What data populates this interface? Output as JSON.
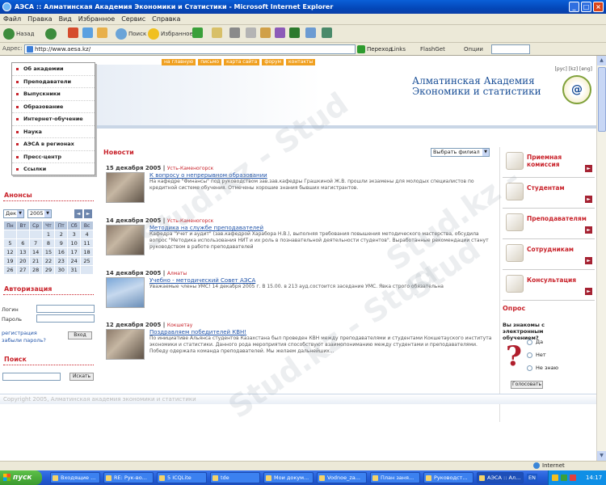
{
  "window": {
    "title": "АЭСА :: Алматинская Академия Экономики и Статистики - Microsoft Internet Explorer",
    "min": "_",
    "max": "□",
    "close": "×"
  },
  "menu": [
    "Файл",
    "Правка",
    "Вид",
    "Избранное",
    "Сервис",
    "Справка"
  ],
  "toolbar": {
    "back": "Назад",
    "search": "Поиск",
    "favorites": "Избранное"
  },
  "address": {
    "label": "Адрес:",
    "url": "http://www.aesa.kz/",
    "go": "Переход",
    "links": "Links",
    "flashget": "FlashGet",
    "options": "Опции"
  },
  "site": {
    "topnav": [
      "на главную",
      "письмо",
      "карта сайта",
      "форум",
      "контакты"
    ],
    "langs": "[рус] [kz] [eng]",
    "academy_line1": "Алматинская Академия",
    "academy_line2": "Экономики и статистики",
    "logo_char": "@",
    "leftnav": [
      "Об академии",
      "Преподаватели",
      "Выпускники",
      "Образование",
      "Интернет-обучение",
      "Наука",
      "АЭСА в регионах",
      "Пресс-центр",
      "Ссылки"
    ],
    "announcements": {
      "title": "Анонсы",
      "month": "Дек",
      "year": "2005",
      "prev": "◄",
      "next": "►",
      "days": [
        "Пн",
        "Вт",
        "Ср",
        "Чт",
        "Пт",
        "Сб",
        "Вс"
      ],
      "weeks": [
        [
          "",
          "",
          "",
          "1",
          "2",
          "3",
          "4"
        ],
        [
          "5",
          "6",
          "7",
          "8",
          "9",
          "10",
          "11"
        ],
        [
          "12",
          "13",
          "14",
          "15",
          "16",
          "17",
          "18"
        ],
        [
          "19",
          "20",
          "21",
          "22",
          "23",
          "24",
          "25"
        ],
        [
          "26",
          "27",
          "28",
          "29",
          "30",
          "31",
          ""
        ]
      ]
    },
    "auth": {
      "title": "Авторизация",
      "login": "Логин",
      "password": "Пароль",
      "register": "регистрация",
      "forgot": "забыли пароль?",
      "enter": "Вход"
    },
    "search": {
      "title": "Поиск",
      "button": "Искать"
    },
    "news": {
      "title": "Новости",
      "filter": "Выбрать филиал",
      "items": [
        {
          "date": "15 декабря 2005",
          "city": "Усть-Каменогорск",
          "title": "К вопросу о непрерывном образовании",
          "text": "На кафедре \"Финансы\" под руководством зав.зав.кафедры Грашкиной Ж.В. прошли экзамены для молодых специалистов по кредитной системе обучения. Отмечены хорошие знания бывших магистрантов."
        },
        {
          "date": "14 декабря 2005",
          "city": "Усть-Каменогорск",
          "title": "Методика на службе преподавателей",
          "text": "Кафедра \"Учет и аудит\" (зав.кафедрой Харабора Н.В.), выполняя требования повышения методического мастерства, обсудила вопрос \"Методика использования НИТ и их роль в познавательной деятельности студентов\". Выработанные рекомендации станут руководством в работе преподавателей"
        },
        {
          "date": "14 декабря 2005",
          "city": "Алматы",
          "title": "Учебно - методический Совет АЭСА",
          "text": "Уважаемые члены УМС! 14 декабря 2005 г. В 15.00. в 213 ауд.состоится заседание УМС. Явка строго обязательна"
        },
        {
          "date": "12 декабря 2005",
          "city": "Кокшетау",
          "title": "Поздравляем победителей КВН!",
          "text": "По инициативе Альянса студентов Казахстана был проведен КВН между преподавателями и студентами Кокшетауского института экономики и статистики. Данного рода мероприятия способствуют взаимопониманию между студентами и преподавателями. Победу одержала команда преподавателей. Мы желаем дальнейших..."
        }
      ]
    },
    "right_buttons": [
      "Приемная комиссия",
      "Студентам",
      "Преподавателям",
      "Сотрудникам",
      "Консультация"
    ],
    "right_go": "►",
    "poll": {
      "title": "Опрос",
      "question": "Вы знакомы с электронным обучением?",
      "mark": "?",
      "options": [
        "Да",
        "Нет",
        "Не знаю"
      ],
      "vote": "Голосовать"
    },
    "copyright": "Copyright 2005, Алматинская академия экономики и статистики"
  },
  "watermark": "Stud.kz - Stud",
  "status": {
    "zone": "Internet"
  },
  "taskbar": {
    "start": "пуск",
    "tasks": [
      "Входящие ...",
      "RE: Рук-во...",
      "5 ICQLite",
      "tde",
      "Мои докум...",
      "Vodnoe_za...",
      "План заня...",
      "Руководст...",
      "АЭСА :: Ал..."
    ],
    "lang": "EN",
    "clock": "14:17"
  }
}
